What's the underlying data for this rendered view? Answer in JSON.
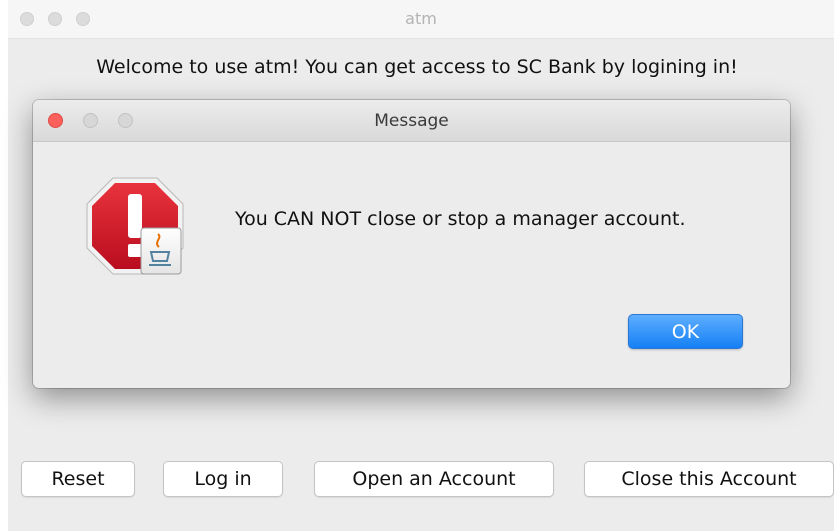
{
  "window": {
    "title": "atm"
  },
  "main": {
    "welcome_text": "Welcome to use atm! You can get access to SC Bank by logining in!",
    "buttons": {
      "reset": "Reset",
      "login": "Log in",
      "open_account": "Open an Account",
      "close_account": "Close this Account"
    }
  },
  "dialog": {
    "title": "Message",
    "icon": "stop-alert-icon",
    "message": "You CAN NOT close or stop a manager account.",
    "ok_label": "OK"
  },
  "colors": {
    "close_button": "#fc605c",
    "ok_button": "#1580f5",
    "alert_red": "#c8102e"
  }
}
